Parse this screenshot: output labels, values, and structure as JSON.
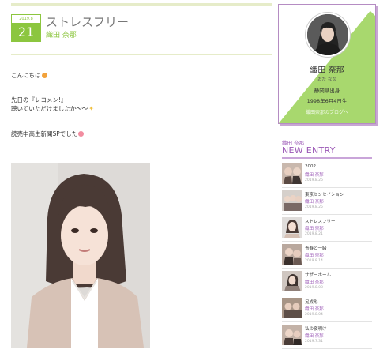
{
  "post": {
    "date_ym": "2019.8",
    "date_day": "21",
    "title": "ストレスフリー",
    "author": "織田 奈那",
    "body": {
      "line1": "こんにちは",
      "line2": "先日の『レコメン!』",
      "line3": "聴いていただけましたか〜〜",
      "line4": "読売中高生新聞SPでした"
    }
  },
  "profile": {
    "name": "織田 奈那",
    "kana": "おだ なな",
    "birthplace": "静岡県出身",
    "birthday": "1998年6月4日生",
    "link": "織田奈那のブログへ"
  },
  "sidebar": {
    "author": "織田 奈那",
    "heading": "NEW ENTRY",
    "entries": [
      {
        "title": "2002",
        "author": "織田 奈那",
        "date": "2019.8.26"
      },
      {
        "title": "東京センセイション",
        "author": "織田 奈那",
        "date": "2019.8.25"
      },
      {
        "title": "ストレスフリー",
        "author": "織田 奈那",
        "date": "2019.8.21"
      },
      {
        "title": "青春と一緒",
        "author": "織田 奈那",
        "date": "2019.8.14"
      },
      {
        "title": "サザーホール",
        "author": "織田 奈那",
        "date": "2019.8.08"
      },
      {
        "title": "足成形",
        "author": "織田 奈那",
        "date": "2019.8.04"
      },
      {
        "title": "私の夜明け",
        "author": "織田 奈那",
        "date": "2019.7.31"
      }
    ]
  },
  "colors": {
    "accent_green": "#8cc63f",
    "accent_purple": "#9b59b6"
  }
}
